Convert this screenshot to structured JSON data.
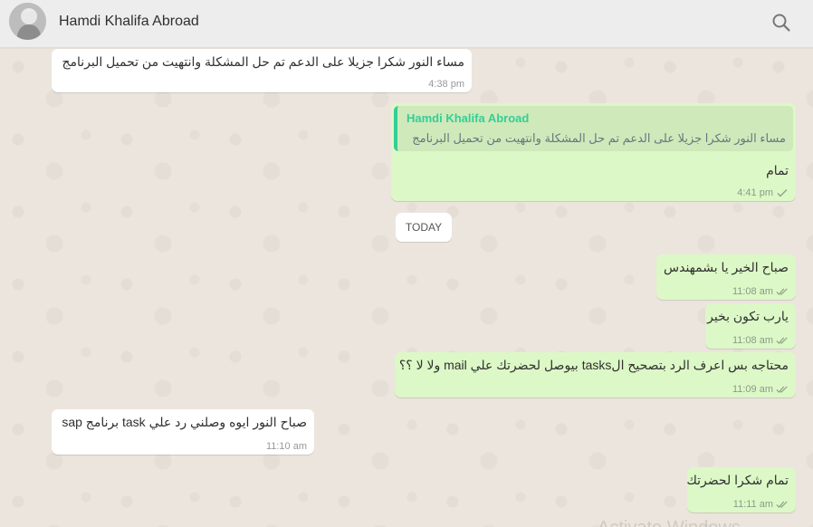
{
  "header": {
    "contact_name": "Hamdi Khalifa Abroad",
    "search_icon": "search-icon"
  },
  "day_separator": "TODAY",
  "messages": [
    {
      "direction": "in",
      "text": "مساء النور  شكرا جزيلا  على  الدعم تم حل المشكلة  وانتهيت من تحميل البرنامج",
      "time": "4:38 pm"
    },
    {
      "direction": "out",
      "quoted_name": "Hamdi Khalifa Abroad",
      "quoted_text": "مساء النور  شكرا جزيلا  على  الدعم تم حل المشكلة  وانتهيت من تحميل البرنامج",
      "text": "تمام",
      "time": "4:41 pm",
      "status": "sent"
    },
    {
      "direction": "out",
      "text": "صباح الخير يا بشمهندس",
      "time": "11:08 am",
      "status": "delivered"
    },
    {
      "direction": "out",
      "text": "يارب تكون بخير",
      "time": "11:08 am",
      "status": "delivered"
    },
    {
      "direction": "out",
      "text": "محتاجه بس اعرف الرد بتصحيح الtasks  بيوصل لحضرتك علي mail ولا لا ؟؟",
      "time": "11:09 am",
      "status": "delivered"
    },
    {
      "direction": "in",
      "text": "صباح النور  ايوه وصلني رد علي task برنامج sap",
      "time": "11:10 am"
    },
    {
      "direction": "out",
      "text": "تمام شكرا لحضرتك",
      "time": "11:11 am",
      "status": "delivered"
    }
  ],
  "watermark": "Activate Windows"
}
